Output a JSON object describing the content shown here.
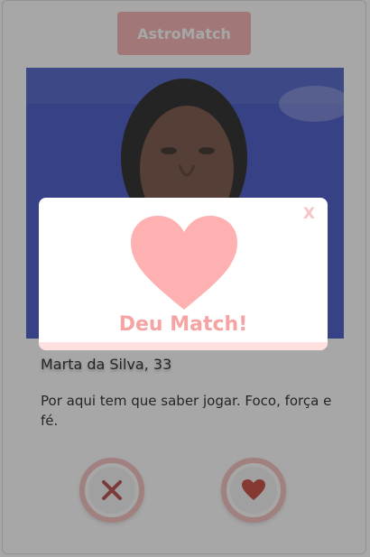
{
  "header": {
    "title": "AstroMatch"
  },
  "profile": {
    "name_age": "Marta da Silva, 33",
    "bio": "Por aqui tem que saber jogar. Foco, força e fé."
  },
  "actions": {
    "reject_icon": "x-icon",
    "like_icon": "heart-icon"
  },
  "match_modal": {
    "close_label": "X",
    "title": "Deu Match!",
    "icon": "heart-icon"
  },
  "colors": {
    "accent_pink": "#f4a8a8",
    "reject_red": "#b23a3a",
    "like_red": "#c0392b",
    "modal_heart": "#ffb0b0",
    "modal_title": "#f5a3a3"
  }
}
